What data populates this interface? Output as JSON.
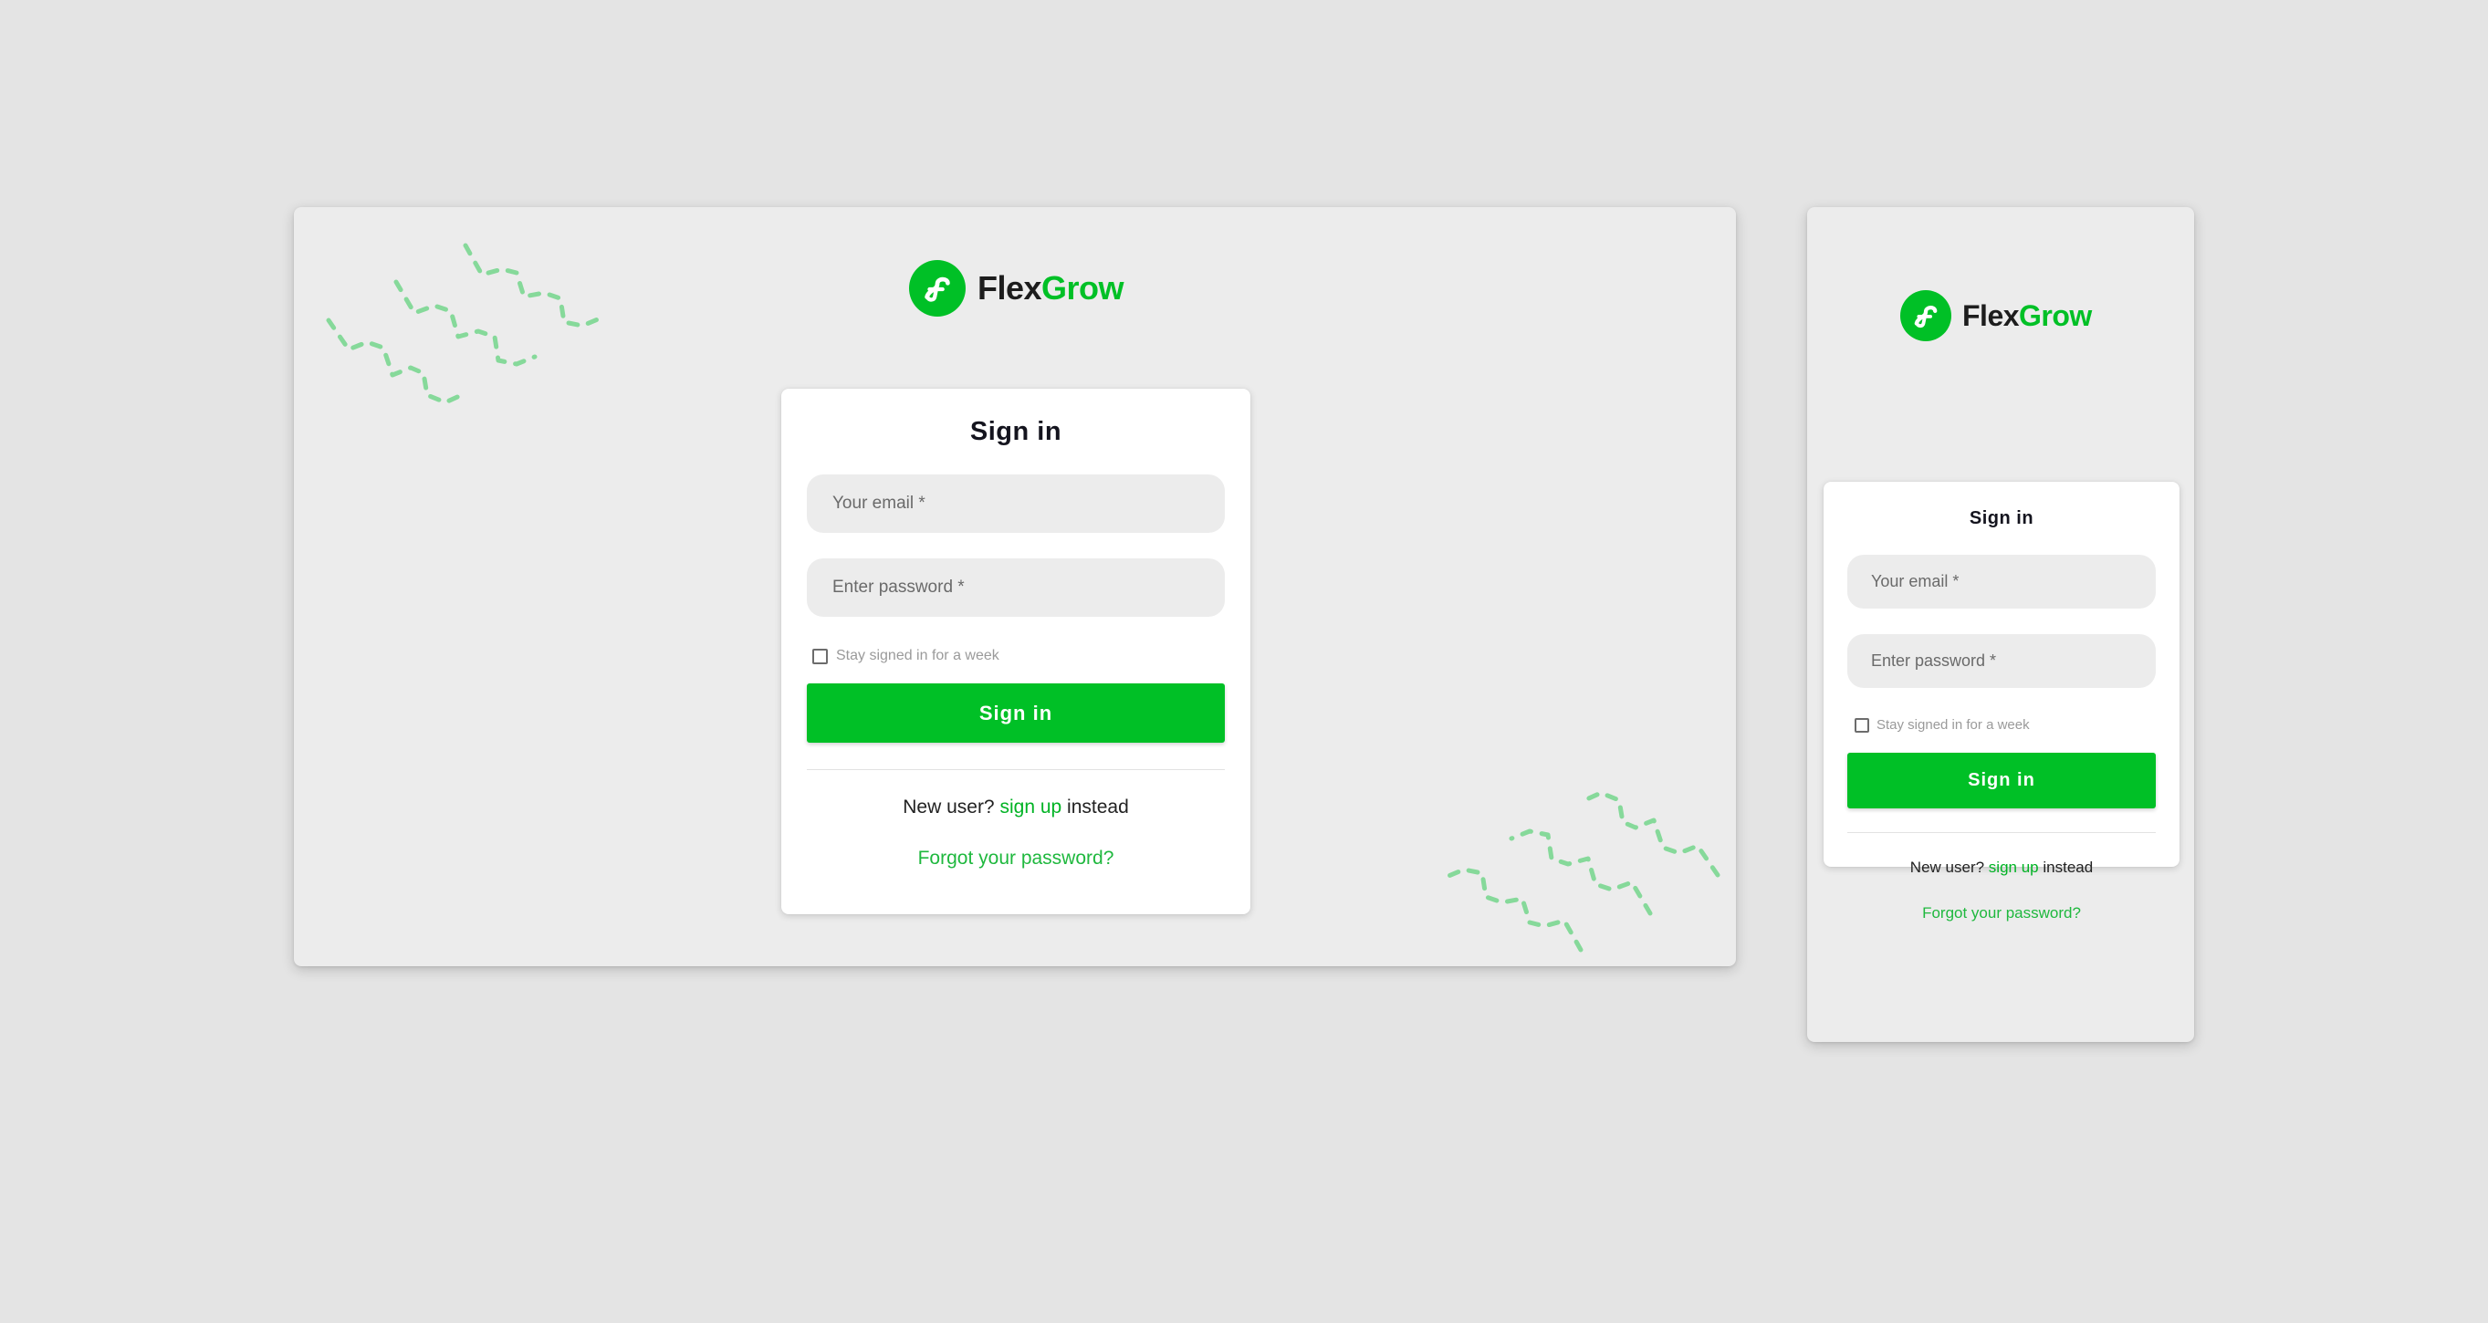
{
  "brand": {
    "name_part1": "Flex",
    "name_part2": "Grow",
    "accent_color": "#00c026",
    "logo_icon": "flexgrow-f-logo-icon"
  },
  "signin_card": {
    "title": "Sign in",
    "email_placeholder": "Your email *",
    "password_placeholder": "Enter password *",
    "remember_label": "Stay signed in for a week",
    "remember_checked": false,
    "submit_label": "Sign in",
    "new_user_prefix": "New user?",
    "signup_link": "sign up",
    "new_user_suffix": "instead",
    "forgot_link": "Forgot your password?"
  },
  "decorations": {
    "squiggle_color": "#86d99a",
    "squiggle_icon": "dashed-zigzag-decoration"
  }
}
